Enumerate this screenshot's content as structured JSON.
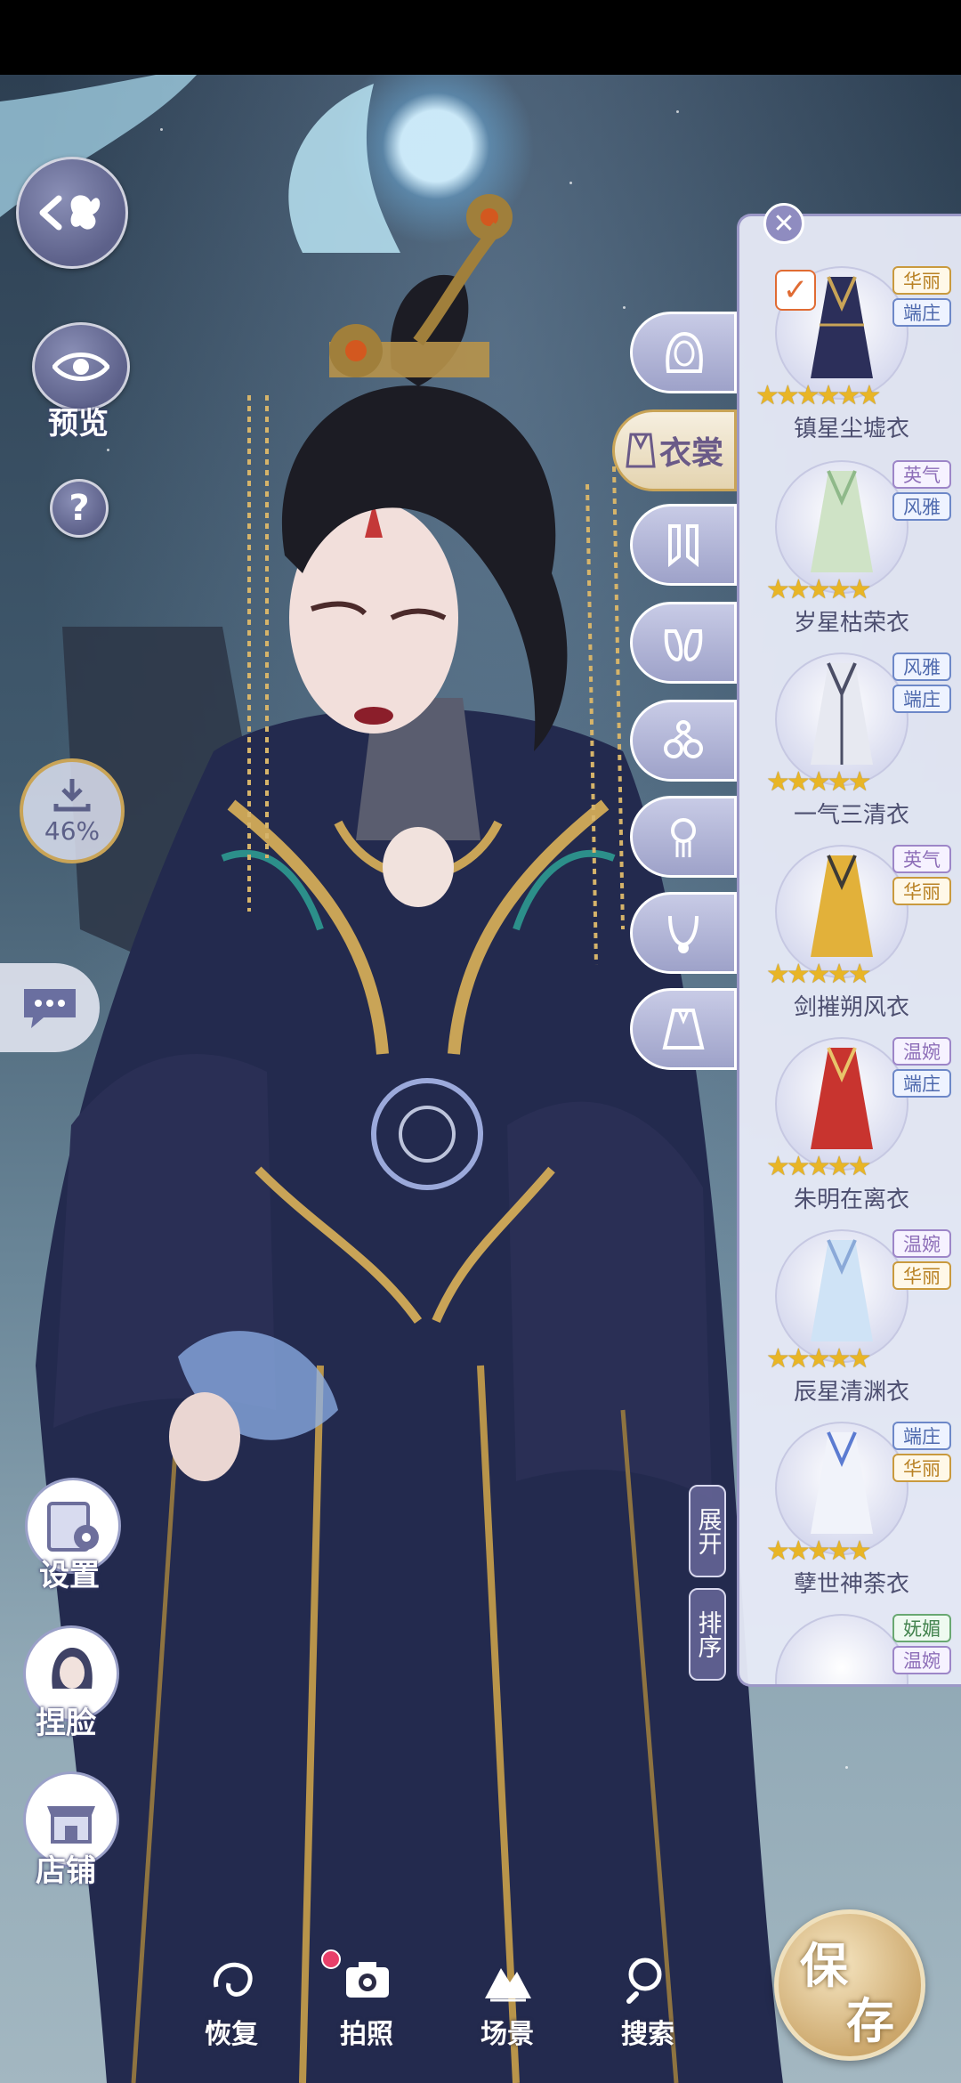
{
  "left_menu": {
    "preview_label": "预览",
    "help_label": "?",
    "download_progress": "46%",
    "settings_label": "设置",
    "face_label": "捏脸",
    "shop_label": "店铺"
  },
  "category_tabs": {
    "active_label": "衣裳",
    "icons": [
      "hair-icon",
      "dress-icon",
      "socks-icon",
      "shoes-icon",
      "accessory-icon",
      "hairpin-icon",
      "necklace-icon",
      "cape-icon"
    ]
  },
  "outfit_panel": {
    "items": [
      {
        "name": "镇星尘墟衣",
        "tags": [
          "华丽",
          "端庄"
        ],
        "stars": "★★★★★★",
        "selected": true
      },
      {
        "name": "岁星枯荣衣",
        "tags": [
          "英气",
          "风雅"
        ],
        "stars": "★★★★★"
      },
      {
        "name": "一气三清衣",
        "tags": [
          "风雅",
          "端庄"
        ],
        "stars": "★★★★★"
      },
      {
        "name": "剑摧朔风衣",
        "tags": [
          "英气",
          "华丽"
        ],
        "stars": "★★★★★"
      },
      {
        "name": "朱明在离衣",
        "tags": [
          "温婉",
          "端庄"
        ],
        "stars": "★★★★★"
      },
      {
        "name": "辰星清渊衣",
        "tags": [
          "温婉",
          "华丽"
        ],
        "stars": "★★★★★"
      },
      {
        "name": "孽世神荼衣",
        "tags": [
          "端庄",
          "华丽"
        ],
        "stars": "★★★★★"
      },
      {
        "name": "",
        "tags": [
          "妩媚",
          "温婉"
        ],
        "stars": ""
      }
    ],
    "expand_label": "展开",
    "sort_label": "排序"
  },
  "bottom_bar": {
    "restore_label": "恢复",
    "photo_label": "拍照",
    "scene_label": "场景",
    "search_label": "搜索",
    "save_label_1": "保",
    "save_label_2": "存"
  },
  "colors": {
    "accent_purple": "#8f8cc0",
    "gold": "#c9a457",
    "star": "#e8b526"
  }
}
